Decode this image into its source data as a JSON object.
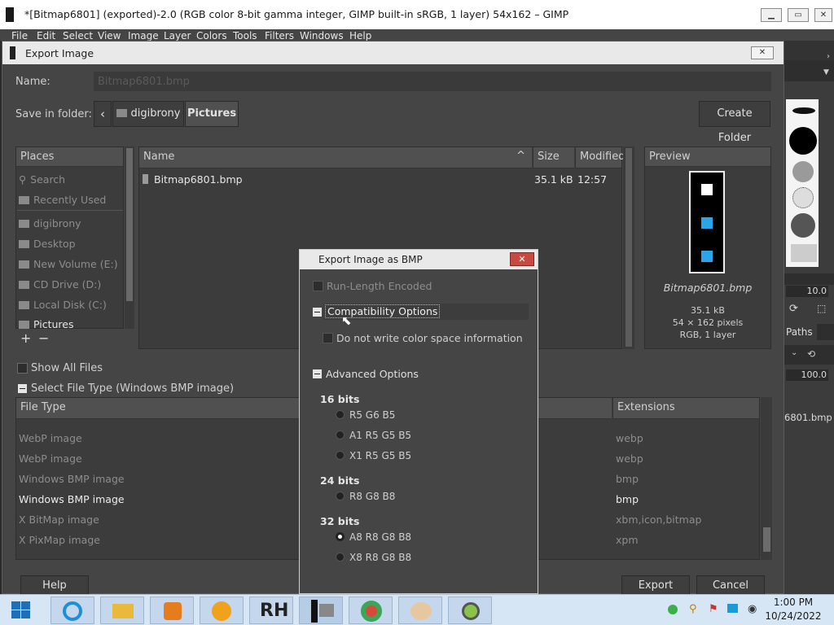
{
  "gimp": {
    "window_title": "*[Bitmap6801] (exported)-2.0 (RGB color 8-bit gamma integer, GIMP built-in sRGB, 1 layer) 54x162 – GIMP",
    "menu": [
      "File",
      "Edit",
      "Select",
      "View",
      "Image",
      "Layer",
      "Colors",
      "Tools",
      "Filters",
      "Windows",
      "Help"
    ],
    "dock": {
      "value1": "10.0",
      "paths_tab": "Paths",
      "value2": "100.0",
      "image_name": "6801.bmp"
    }
  },
  "export": {
    "title": "Export Image",
    "name_label": "Name:",
    "name_value": "Bitmap6801.bmp",
    "save_in_label": "Save in folder:",
    "crumbs": [
      "digibrony",
      "Pictures"
    ],
    "create_folder": "Create Folder",
    "places_header": "Places",
    "places": [
      "Search",
      "Recently Used",
      "digibrony",
      "Desktop",
      "New Volume (E:)",
      "CD Drive (D:)",
      "Local Disk (C:)",
      "Pictures"
    ],
    "files_header": {
      "name": "Name",
      "size": "Size",
      "modified": "Modified"
    },
    "files": [
      {
        "name": "Bitmap6801.bmp",
        "size": "35.1 kB",
        "modified": "12:57"
      }
    ],
    "preview_header": "Preview",
    "preview": {
      "filename": "Bitmap6801.bmp",
      "size": "35.1 kB",
      "dims": "54 × 162 pixels",
      "mode": "RGB, 1 layer"
    },
    "show_all_files": "Show All Files",
    "select_file_type": "Select File Type (Windows BMP image)",
    "filetype_header": {
      "type": "File Type",
      "ext": "Extensions"
    },
    "filetypes": [
      {
        "type": "WebP image",
        "ext": "webp"
      },
      {
        "type": "WebP image",
        "ext": "webp"
      },
      {
        "type": "Windows BMP image",
        "ext": "bmp"
      },
      {
        "type": "Windows BMP image",
        "ext": "bmp"
      },
      {
        "type": "X BitMap image",
        "ext": "xbm,icon,bitmap"
      },
      {
        "type": "X PixMap image",
        "ext": "xpm"
      }
    ],
    "help": "Help",
    "export_btn": "Export",
    "cancel": "Cancel"
  },
  "bmp_dialog": {
    "title": "Export Image as BMP",
    "run_length": "Run-Length Encoded",
    "compat": "Compatibility Options",
    "no_color_space": "Do not write color space information",
    "advanced": "Advanced Options",
    "g16": "16 bits",
    "r565": "R5 G6 B5",
    "a1555": "A1 R5 G5 B5",
    "x1555": "X1 R5 G5 B5",
    "g24": "24 bits",
    "r888": "R8 G8 B8",
    "g32": "32 bits",
    "a8888": "A8 R8 G8 B8",
    "x8888": "X8 R8 G8 B8"
  },
  "taskbar": {
    "time": "1:00 PM",
    "date": "10/24/2022",
    "rh_label": "RH"
  }
}
